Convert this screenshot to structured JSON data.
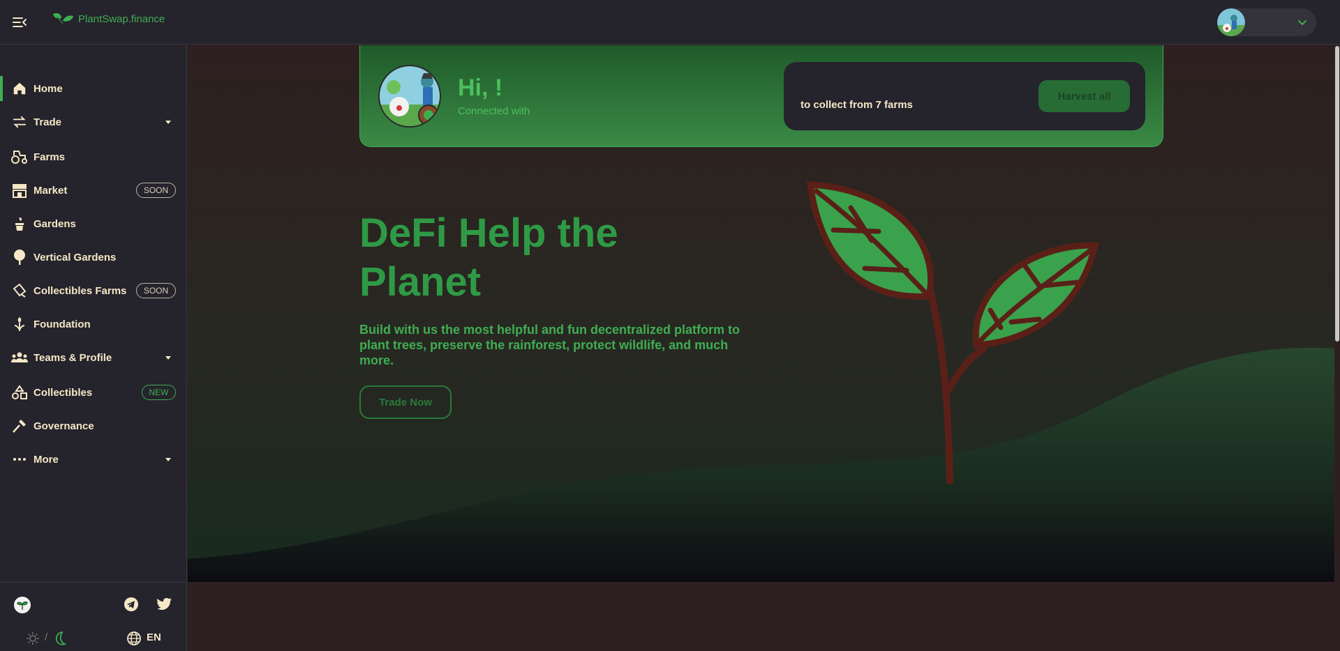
{
  "header": {
    "logo_text": "PlantSwap.finance"
  },
  "sidebar": {
    "items": [
      {
        "label": "Home",
        "icon": "home-icon"
      },
      {
        "label": "Trade",
        "icon": "swap-icon"
      },
      {
        "label": "Farms",
        "icon": "tractor-icon"
      },
      {
        "label": "Market",
        "icon": "market-icon",
        "badge": "SOON"
      },
      {
        "label": "Gardens",
        "icon": "potted-plant-icon"
      },
      {
        "label": "Vertical Gardens",
        "icon": "tree-icon"
      },
      {
        "label": "Collectibles Farms",
        "icon": "watering-can-icon",
        "badge": "SOON"
      },
      {
        "label": "Foundation",
        "icon": "hand-plant-icon"
      },
      {
        "label": "Teams & Profile",
        "icon": "team-icon"
      },
      {
        "label": "Collectibles",
        "icon": "shapes-icon",
        "badge": "NEW"
      },
      {
        "label": "Governance",
        "icon": "gavel-icon"
      },
      {
        "label": "More",
        "icon": "more-dots-icon"
      }
    ],
    "footer": {
      "theme_separator": "/",
      "language": "EN"
    }
  },
  "welcome": {
    "greeting": "Hi, !",
    "connected": "Connected with",
    "harvest_text": "to collect from 7 farms",
    "harvest_button": "Harvest all"
  },
  "hero": {
    "title": "DeFi Help the Planet",
    "subtitle": "Build with us the most helpful and fun decentralized platform to plant trees, preserve the rainforest, protect wildlife, and much more.",
    "cta": "Trade Now"
  },
  "colors": {
    "accent": "#3fae52",
    "sidebar_bg": "#25232b",
    "page_bg": "#2e2020",
    "text": "#f5e8c7"
  }
}
